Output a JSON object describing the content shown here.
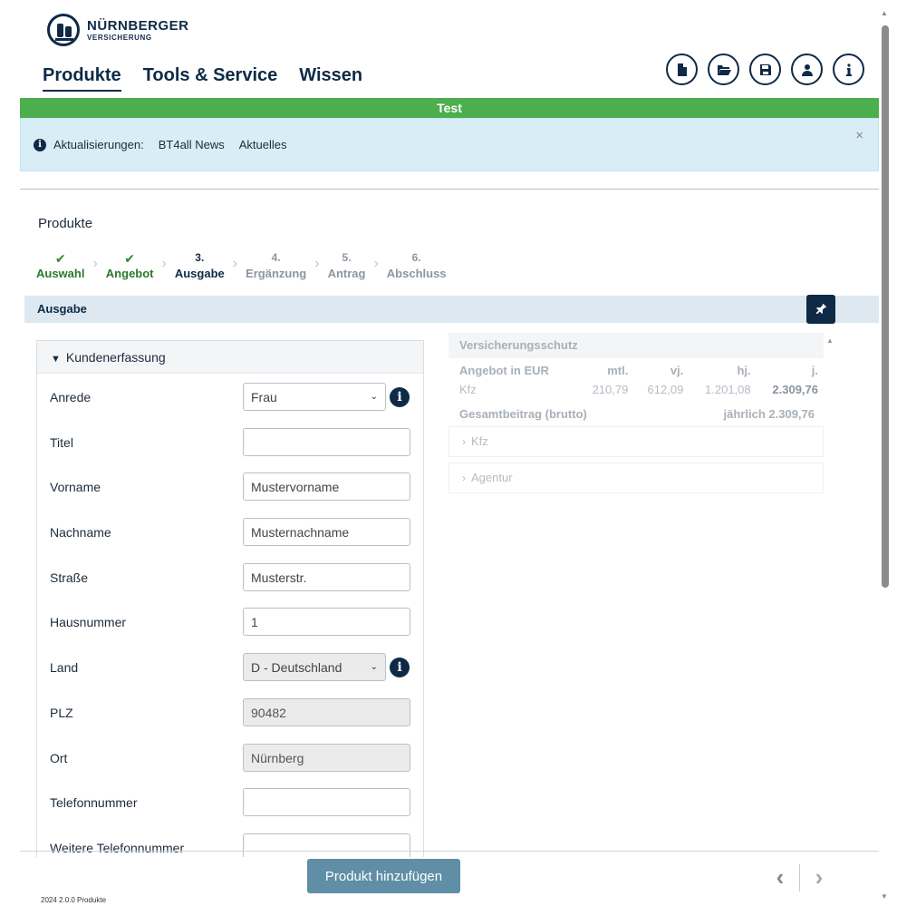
{
  "brand": {
    "name": "NÜRNBERGER",
    "sub": "VERSICHERUNG"
  },
  "nav": {
    "items": [
      {
        "label": "Produkte"
      },
      {
        "label": "Tools & Service"
      },
      {
        "label": "Wissen"
      }
    ]
  },
  "toolbar": {
    "icons": [
      "new-document-icon",
      "open-folder-icon",
      "save-icon",
      "user-icon",
      "info-icon"
    ]
  },
  "env_label": "Test",
  "notice": {
    "label": "Aktualisierungen:",
    "links": [
      "BT4all News",
      "Aktuelles"
    ],
    "close": "×"
  },
  "page_title": "Produkte",
  "steps": [
    {
      "mark": "✔",
      "label": "Auswahl",
      "state": "done"
    },
    {
      "mark": "✔",
      "label": "Angebot",
      "state": "done"
    },
    {
      "mark": "3.",
      "label": "Ausgabe",
      "state": "current"
    },
    {
      "mark": "4.",
      "label": "Ergänzung",
      "state": "todo"
    },
    {
      "mark": "5.",
      "label": "Antrag",
      "state": "todo"
    },
    {
      "mark": "6.",
      "label": "Abschluss",
      "state": "todo"
    }
  ],
  "section_title": "Ausgabe",
  "form": {
    "header": "Kundenerfassung",
    "fields": {
      "anrede": {
        "label": "Anrede",
        "value": "Frau"
      },
      "titel": {
        "label": "Titel",
        "value": ""
      },
      "vorname": {
        "label": "Vorname",
        "value": "Mustervorname"
      },
      "nachname": {
        "label": "Nachname",
        "value": "Musternachname"
      },
      "strasse": {
        "label": "Straße",
        "value": "Musterstr."
      },
      "hausnummer": {
        "label": "Hausnummer",
        "value": "1"
      },
      "land": {
        "label": "Land",
        "value": "D - Deutschland"
      },
      "plz": {
        "label": "PLZ",
        "value": "90482"
      },
      "ort": {
        "label": "Ort",
        "value": "Nürnberg"
      },
      "telefon": {
        "label": "Telefonnummer",
        "value": ""
      },
      "telefon2": {
        "label": "Weitere Telefonnummer",
        "value": ""
      }
    }
  },
  "summary": {
    "title": "Versicherungsschutz",
    "columns": [
      "Angebot in EUR",
      "mtl.",
      "vj.",
      "hj.",
      "j."
    ],
    "row": {
      "name": "Kfz",
      "mtl": "210,79",
      "vj": "612,09",
      "hj": "1.201,08",
      "j": "2.309,76"
    },
    "total_label": "Gesamtbeitrag (brutto)",
    "total_value": "jährlich 2.309,76",
    "sections": [
      "Kfz",
      "Agentur"
    ]
  },
  "footer": {
    "add_button": "Produkt hinzufügen",
    "version": "2024 2.0.0 Produkte"
  }
}
